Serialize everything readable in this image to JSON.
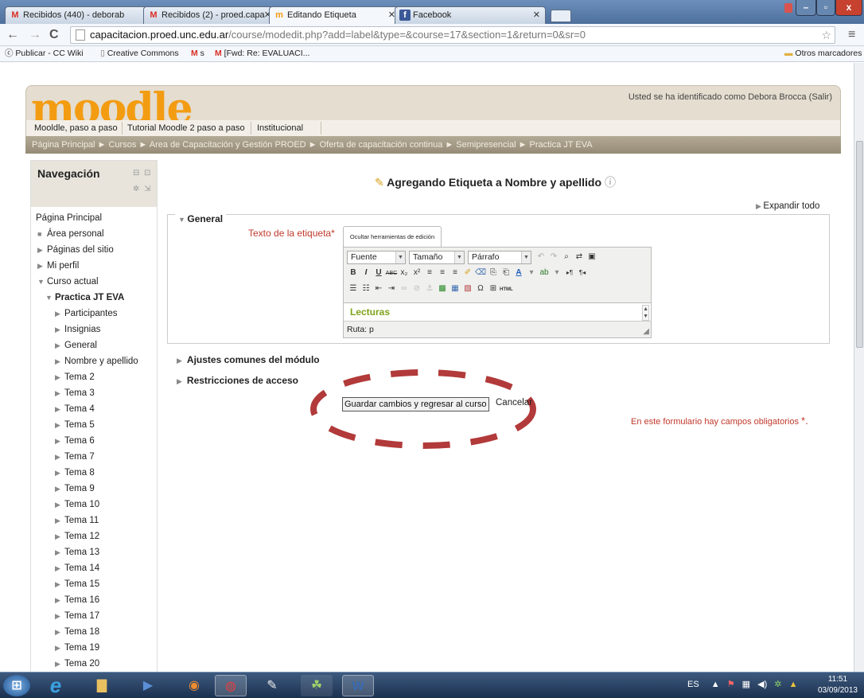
{
  "browser": {
    "tabs": [
      {
        "label": "Recibidos (440) - deborab",
        "icon": "M",
        "active": false
      },
      {
        "label": "Recibidos (2) - proed.capa",
        "icon": "M",
        "active": false
      },
      {
        "label": "Editando Etiqueta",
        "icon": "m",
        "active": true
      },
      {
        "label": "Facebook",
        "icon": "f",
        "active": false
      }
    ],
    "url_host": "capacitacion.proed.unc.edu.ar",
    "url_path": "/course/modedit.php?add=label&type=&course=17&section=1&return=0&sr=0",
    "bookmarks": [
      "Publicar - CC Wiki",
      "Creative Commons",
      "s",
      "[Fwd: Re: EVALUACI..."
    ],
    "other_bookmarks": "Otros marcadores",
    "window_buttons": [
      "–",
      "▫",
      "x"
    ]
  },
  "moodle": {
    "logo": "moodle",
    "login_text": "Usted se ha identificado como Debora Brocca (Salir)",
    "menu": [
      "Mooldle, paso a paso",
      "Tutorial Moodle 2 paso a paso",
      "Institucional"
    ],
    "breadcrumb": "Página Principal ► Cursos ► Area de Capacitación y Gestión PROED ► Oferta de capacitación continua ► Semipresencial ► Practica JT EVA"
  },
  "nav": {
    "title": "Navegación",
    "items": [
      "Página Principal",
      "Área personal",
      "Páginas del sitio",
      "Mi perfil",
      "Curso actual",
      "Practica JT EVA",
      "Participantes",
      "Insignias",
      "General",
      "Nombre y apellido",
      "Tema 2",
      "Tema 3",
      "Tema 4",
      "Tema 5",
      "Tema 6",
      "Tema 7",
      "Tema 8",
      "Tema 9",
      "Tema 10",
      "Tema 11",
      "Tema 12",
      "Tema 13",
      "Tema 14",
      "Tema 15",
      "Tema 16",
      "Tema 17",
      "Tema 18",
      "Tema 19",
      "Tema 20"
    ]
  },
  "main": {
    "title": "Agregando Etiqueta a Nombre y apellido",
    "expand_all": "Expandir todo",
    "general_legend": "General",
    "label_field": "Texto de la etiqueta",
    "required_mark": "*",
    "editor_tab": "Ocultar herramientas de edición",
    "font_select": "Fuente",
    "size_select": "Tamaño",
    "format_select": "Párrafo",
    "editor_content": "Lecturas",
    "editor_path": "Ruta: p",
    "section_common": "Ajustes comunes del módulo",
    "section_access": "Restricciones de acceso",
    "save_button": "Guardar cambios y regresar al curso",
    "cancel": "Cancelar",
    "required_note": "En este formulario hay campos obligatorios",
    "required_star": "*."
  },
  "taskbar": {
    "lang": "ES",
    "time": "11:51",
    "date": "03/09/2013"
  },
  "colors": {
    "required": "#c0392b",
    "accent_oval": "#b23a3a",
    "editor_text": "#7fa31a",
    "logo": "#f39c12"
  }
}
